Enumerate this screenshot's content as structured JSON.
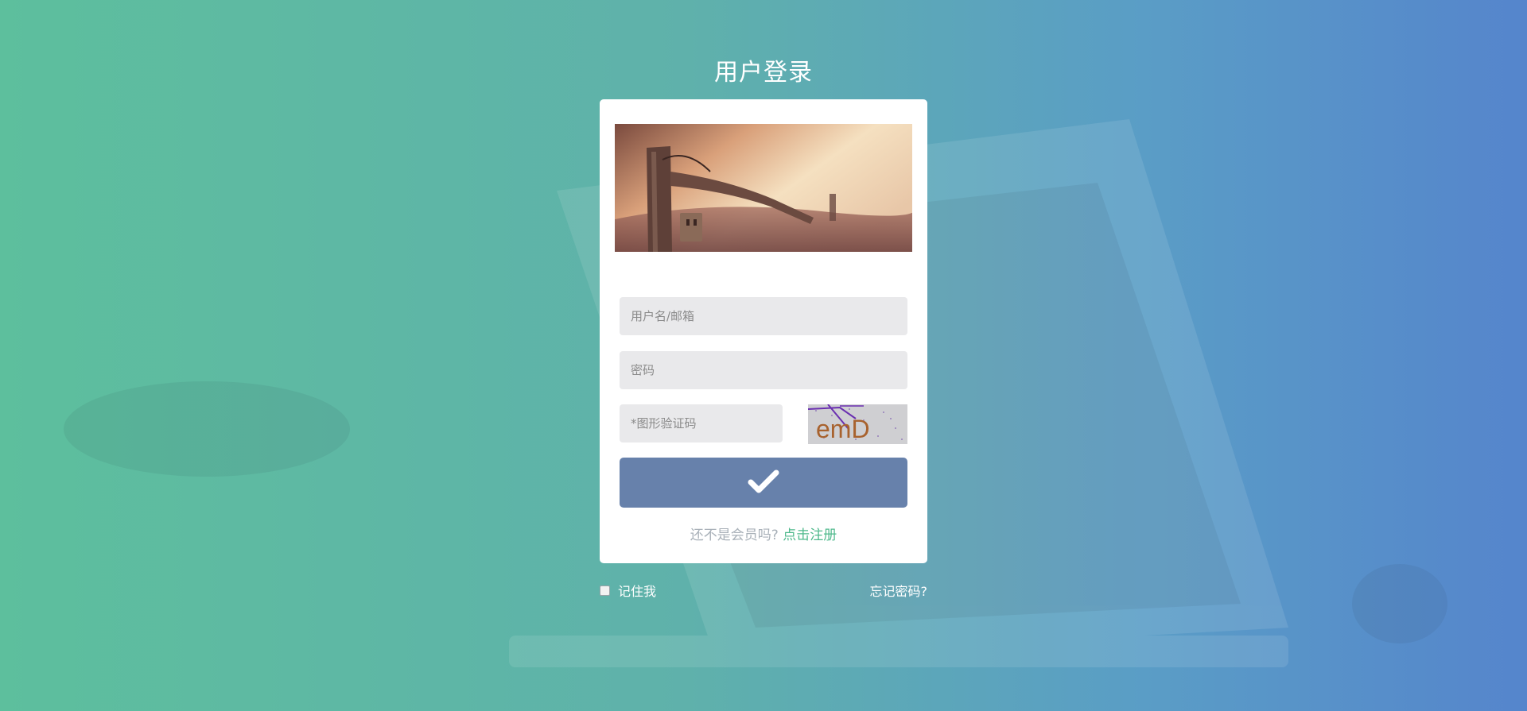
{
  "page": {
    "title": "用户登录"
  },
  "form": {
    "username_placeholder": "用户名/邮箱",
    "password_placeholder": "密码",
    "captcha_placeholder": "*图形验证码",
    "captcha_text": "emD",
    "submit_icon": "checkmark-icon"
  },
  "register": {
    "prompt": "还不是会员吗?",
    "link": "点击注册"
  },
  "footer": {
    "remember_label": "记住我",
    "forgot_label": "忘记密码?"
  },
  "colors": {
    "accent_green": "#4fb98c",
    "submit_bg": "#6781ab",
    "bg_left": "#5dbf9d",
    "bg_right": "#5585cc"
  }
}
